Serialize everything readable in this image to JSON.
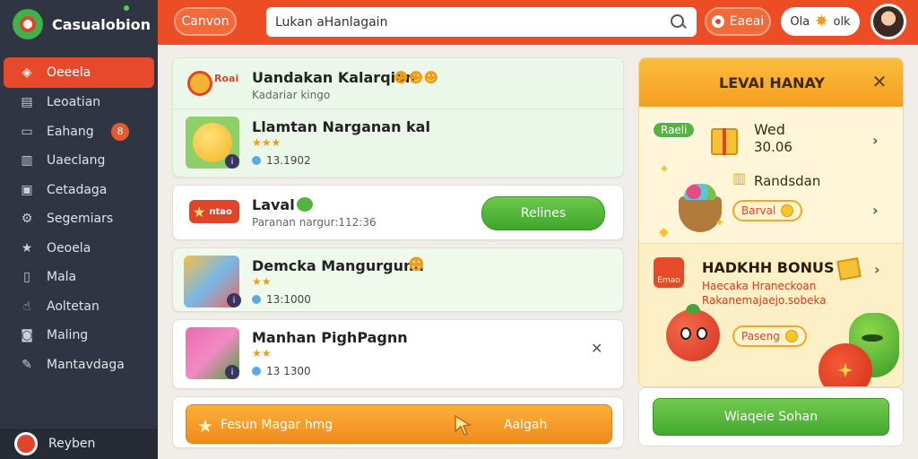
{
  "sidebar": {
    "brand": "Casualobion",
    "items": [
      {
        "label": "Oeeela",
        "icon": "tag-icon"
      },
      {
        "label": "Leoatian",
        "icon": "document-icon"
      },
      {
        "label": "Eahang",
        "icon": "card-icon",
        "badge": "8"
      },
      {
        "label": "Uaeclang",
        "icon": "chart-icon"
      },
      {
        "label": "Cetadaga",
        "icon": "image-icon"
      },
      {
        "label": "Segemiars",
        "icon": "gear-icon"
      },
      {
        "label": "Oeoela",
        "icon": "star-icon"
      },
      {
        "label": "Mala",
        "icon": "book-icon"
      },
      {
        "label": "Aoltetan",
        "icon": "thumb-icon"
      },
      {
        "label": "Maling",
        "icon": "camera-icon"
      },
      {
        "label": "Mantavdaga",
        "icon": "pencil-icon"
      }
    ],
    "user": "Reyben"
  },
  "topbar": {
    "canvas_label": "Canvon",
    "search_value": "Lukan aHanlagain",
    "alert_label": "Eaeai",
    "stats_left": "Ola",
    "stats_right": "olk"
  },
  "list": {
    "header": {
      "title": "Uandakan Kalarqian",
      "subtitle": "Kadariar kingo",
      "icon_text": "Roai"
    },
    "featured": {
      "title": "Llamtan Narganan kal",
      "count": "13.1902"
    },
    "level": {
      "icon_text": "ntao",
      "title": "Laval",
      "subtitle": "Paranan nargur:112:36",
      "button": "Relines"
    },
    "dm": {
      "title": "Demcka Mangurgunn",
      "count": "13:1000"
    },
    "mp": {
      "title": "Manhan PighPagnn",
      "count": "13 1300"
    },
    "promo": {
      "left": "Fesun Magar hmg",
      "right": "Aalgah"
    }
  },
  "rewards": {
    "title": "LEVAI HANAY",
    "tag": "Raeli",
    "item1_title": "Wed",
    "item1_value": "30.06",
    "item2_title": "Randsdan",
    "item2_pill": "Barval",
    "bonus_icon_text": "Emao",
    "bonus_title": "HADKHH BONUS",
    "bonus_sub1": "Haecaka Hraneckoan",
    "bonus_sub2": "Rakanemajaejo.sobeka",
    "bonus_pill": "Paseng",
    "confirm": "Wiaqeie Sohan"
  }
}
